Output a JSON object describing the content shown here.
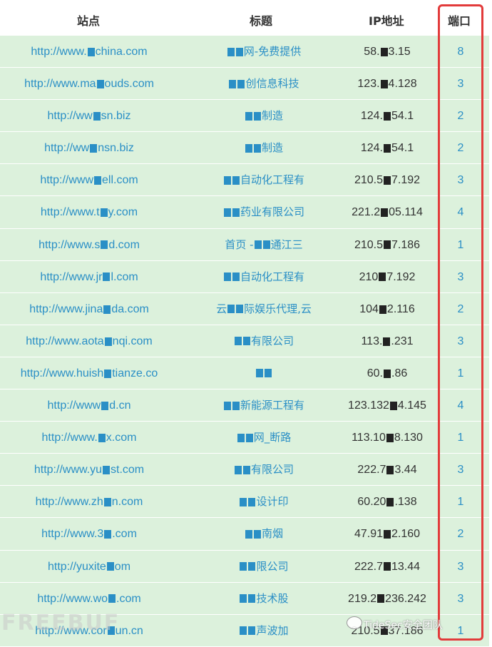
{
  "header": {
    "site": "站点",
    "title": "标题",
    "ip": "IP地址",
    "port": "端口"
  },
  "rows": [
    {
      "site_a": "http://www.",
      "site_b": "china.com",
      "title_a": "",
      "title_b": "网-免费提供",
      "ip_a": "58.",
      "ip_b": "3.15",
      "port": "8"
    },
    {
      "site_a": "http://www.ma",
      "site_b": "ouds.com",
      "title_a": "",
      "title_b": "创信息科技",
      "ip_a": "123.",
      "ip_b": "4.128",
      "port": "3"
    },
    {
      "site_a": "http://ww",
      "site_b": "sn.biz",
      "title_a": "",
      "title_b": "制造",
      "ip_a": "124.",
      "ip_b": "54.1",
      "port": "2"
    },
    {
      "site_a": "http://ww",
      "site_b": "nsn.biz",
      "title_a": "",
      "title_b": "制造",
      "ip_a": "124.",
      "ip_b": "54.1",
      "port": "2"
    },
    {
      "site_a": "http://www",
      "site_b": "ell.com",
      "title_a": "",
      "title_b": "自动化工程有",
      "ip_a": "210.5",
      "ip_b": "7.192",
      "port": "3"
    },
    {
      "site_a": "http://www.t",
      "site_b": "y.com",
      "title_a": "",
      "title_b": "药业有限公司",
      "ip_a": "221.2",
      "ip_b": "05.114",
      "port": "4"
    },
    {
      "site_a": "http://www.s",
      "site_b": "d.com",
      "title_a": "首页 -",
      "title_b": "通江三",
      "ip_a": "210.5",
      "ip_b": "7.186",
      "port": "1"
    },
    {
      "site_a": "http://www.jr",
      "site_b": "l.com",
      "title_a": "",
      "title_b": "自动化工程有",
      "ip_a": "210",
      "ip_b": "7.192",
      "port": "3"
    },
    {
      "site_a": "http://www.jina",
      "site_b": "da.com",
      "title_a": "云",
      "title_b": "际娱乐代理,云",
      "ip_a": "104",
      "ip_b": "2.116",
      "port": "2"
    },
    {
      "site_a": "http://www.aota",
      "site_b": "nqi.com",
      "title_a": "",
      "title_b": "有限公司",
      "ip_a": "113.",
      "ip_b": ".231",
      "port": "3"
    },
    {
      "site_a": "http://www.huish",
      "site_b": "tianze.co",
      "title_a": "",
      "title_b": "",
      "ip_a": "60.",
      "ip_b": ".86",
      "port": "1"
    },
    {
      "site_a": "http://www",
      "site_b": "d.cn",
      "title_a": "",
      "title_b": "新能源工程有",
      "ip_a": "123.132",
      "ip_b": "4.145",
      "port": "4"
    },
    {
      "site_a": "http://www.",
      "site_b": "x.com",
      "title_a": "",
      "title_b": "网_断路",
      "ip_a": "113.10",
      "ip_b": "8.130",
      "port": "1"
    },
    {
      "site_a": "http://www.yu",
      "site_b": "st.com",
      "title_a": "",
      "title_b": "有限公司",
      "ip_a": "222.7",
      "ip_b": "3.44",
      "port": "3"
    },
    {
      "site_a": "http://www.zh",
      "site_b": "n.com",
      "title_a": "",
      "title_b": "设计印",
      "ip_a": "60.20",
      "ip_b": ".138",
      "port": "1"
    },
    {
      "site_a": "http://www.3",
      "site_b": ".com",
      "title_a": "",
      "title_b": "南烟",
      "ip_a": "47.91",
      "ip_b": "2.160",
      "port": "2"
    },
    {
      "site_a": "http://yuxite",
      "site_b": "om",
      "title_a": "",
      "title_b": "限公司",
      "ip_a": "222.7",
      "ip_b": "13.44",
      "port": "3"
    },
    {
      "site_a": "http://www.wo",
      "site_b": ".com",
      "title_a": "",
      "title_b": "技术股",
      "ip_a": "219.2",
      "ip_b": "236.242",
      "port": "3"
    },
    {
      "site_a": "http://www.cor",
      "site_b": "un.cn",
      "title_a": "",
      "title_b": "声波加",
      "ip_a": "210.5",
      "ip_b": "37.186",
      "port": "1"
    }
  ],
  "watermark_left": "FREEBUF",
  "watermark_right": "TideSec安全团队",
  "colors": {
    "row_bg": "#dcf1dc",
    "link": "#2a8fc6",
    "highlight": "#e23b3b"
  }
}
